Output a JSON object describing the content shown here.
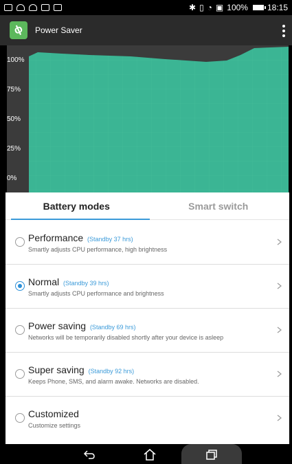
{
  "status_bar": {
    "battery_percent": "100%",
    "time": "18:15"
  },
  "app": {
    "title": "Power Saver",
    "logo_icon": "leaf-icon"
  },
  "battery_graph": {
    "y_labels": [
      "100%",
      "75%",
      "50%",
      "25%",
      "0%"
    ],
    "fill_color": "#3bb594"
  },
  "tabs": [
    {
      "label": "Battery modes",
      "active": true
    },
    {
      "label": "Smart switch",
      "active": false
    }
  ],
  "modes": [
    {
      "name": "Performance",
      "standby": "(Standby 37 hrs)",
      "description": "Smartly adjusts CPU performance, high brightness",
      "selected": false
    },
    {
      "name": "Normal",
      "standby": "(Standby 39 hrs)",
      "description": "Smartly adjusts CPU performance and brightness",
      "selected": true
    },
    {
      "name": "Power saving",
      "standby": "(Standby 69 hrs)",
      "description": "Networks will be temporarily disabled shortly after your device is asleep",
      "selected": false
    },
    {
      "name": "Super saving",
      "standby": "(Standby 92 hrs)",
      "description": "Keeps Phone, SMS, and alarm awake. Networks are disabled.",
      "selected": false
    },
    {
      "name": "Customized",
      "standby": "",
      "description": "Customize settings",
      "selected": false
    }
  ],
  "colors": {
    "accent": "#3a9ad9",
    "graph_fill": "#3bb594"
  }
}
